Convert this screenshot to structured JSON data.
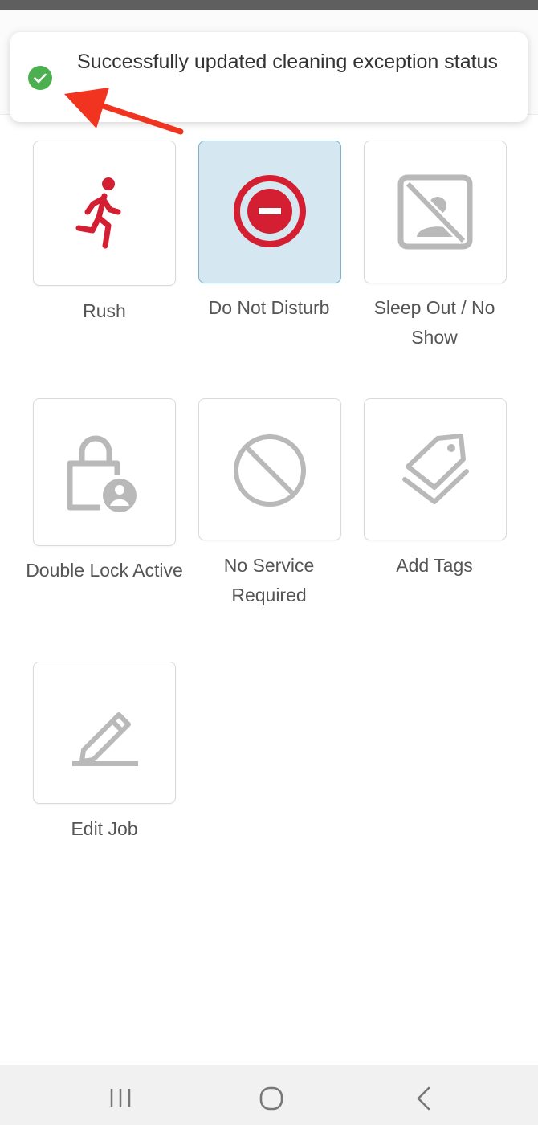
{
  "toast": {
    "message": "Successfully updated cleaning exception status",
    "status": "success",
    "icon": "check-circle-icon",
    "status_color": "#4caf50"
  },
  "annotation": {
    "icon": "red-arrow-icon",
    "color": "#f0341f"
  },
  "actions": [
    {
      "label": "Rush",
      "icon": "running-person-icon",
      "selected": false,
      "icon_color": "#d31f31"
    },
    {
      "label": "Do Not Disturb",
      "icon": "do-not-disturb-icon",
      "selected": true,
      "icon_color": "#d31f31"
    },
    {
      "label": "Sleep Out / No Show",
      "icon": "no-profile-image-icon",
      "selected": false,
      "icon_color": "#b9b9b9"
    },
    {
      "label": "Double Lock Active",
      "icon": "lock-person-icon",
      "selected": false,
      "icon_color": "#b9b9b9"
    },
    {
      "label": "No Service Required",
      "icon": "prohibited-icon",
      "selected": false,
      "icon_color": "#b9b9b9"
    },
    {
      "label": "Add Tags",
      "icon": "tags-icon",
      "selected": false,
      "icon_color": "#b9b9b9"
    },
    {
      "label": "Edit Job",
      "icon": "pencil-icon",
      "selected": false,
      "icon_color": "#b9b9b9"
    }
  ],
  "navigation": {
    "recents_icon": "recent-apps-icon",
    "home_icon": "home-icon",
    "back_icon": "back-icon"
  }
}
